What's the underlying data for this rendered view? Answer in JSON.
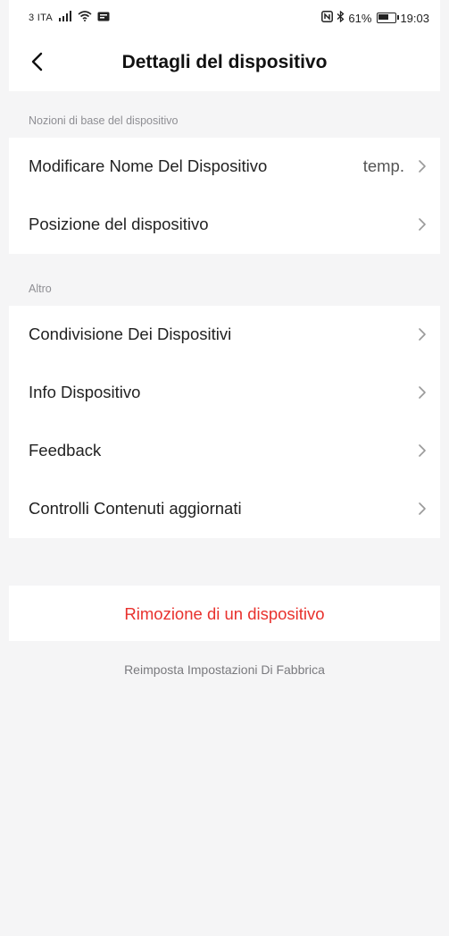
{
  "status_bar": {
    "carrier": "3 ITA",
    "battery": "61%",
    "time": "19:03",
    "icons": [
      "signal-icon",
      "wifi-icon",
      "notification-icon",
      "nfc-icon",
      "bluetooth-icon",
      "battery-icon"
    ]
  },
  "header": {
    "title": "Dettagli del dispositivo",
    "back_icon": "chevron-left-icon"
  },
  "sections": {
    "basics": {
      "label": "Nozioni di base del dispositivo",
      "items": [
        {
          "label": "Modificare Nome Del Dispositivo",
          "value": "temp."
        },
        {
          "label": "Posizione del dispositivo"
        }
      ]
    },
    "other": {
      "label": "Altro",
      "items": [
        {
          "label": "Condivisione Dei Dispositivi"
        },
        {
          "label": "Info Dispositivo"
        },
        {
          "label": "Feedback"
        },
        {
          "label": "Controlli Contenuti aggiornati"
        }
      ]
    }
  },
  "actions": {
    "remove_device": "Rimozione di un dispositivo",
    "factory_reset": "Reimposta Impostazioni Di Fabbrica"
  },
  "colors": {
    "accent_red": "#e8312d",
    "background": "#f5f5f6",
    "card": "#ffffff"
  }
}
